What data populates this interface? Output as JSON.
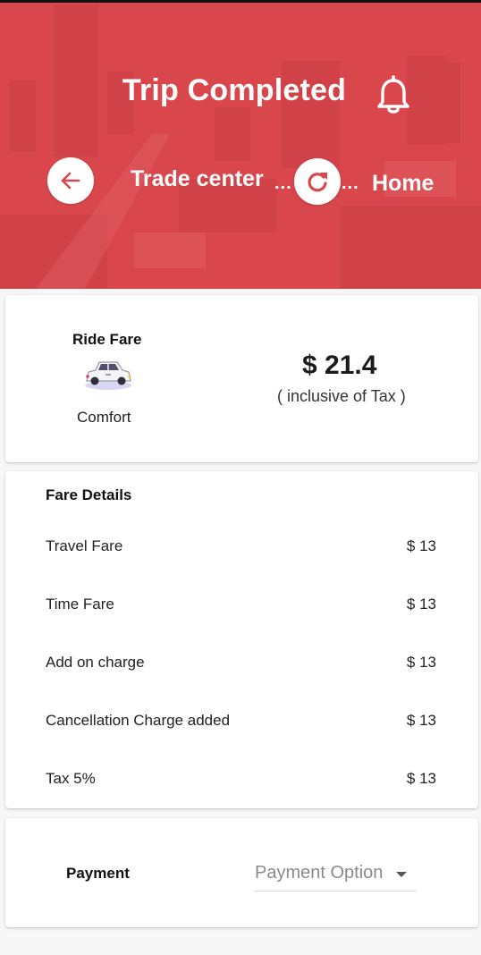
{
  "header": {
    "title": "Trip Completed",
    "from": "Trade center",
    "to": "Home",
    "dots": "...",
    "accent_color": "#d9474c",
    "icons": {
      "back": "arrow-left-icon",
      "refresh": "refresh-icon",
      "notifications": "bell-icon"
    }
  },
  "fare_card": {
    "title": "Ride Fare",
    "car_icon": "car-icon",
    "car_type": "Comfort",
    "amount": "$ 21.4",
    "note": "( inclusive of Tax )"
  },
  "fare_details": {
    "title": "Fare Details",
    "rows": [
      {
        "label": "Travel Fare",
        "value": "$ 13"
      },
      {
        "label": "Time Fare",
        "value": "$ 13"
      },
      {
        "label": "Add on charge",
        "value": "$ 13"
      },
      {
        "label": "Cancellation Charge added",
        "value": "$ 13"
      },
      {
        "label": "Tax 5%",
        "value": "$ 13"
      }
    ]
  },
  "payment": {
    "label": "Payment",
    "placeholder": "Payment Option",
    "caret_icon": "caret-down-icon"
  }
}
